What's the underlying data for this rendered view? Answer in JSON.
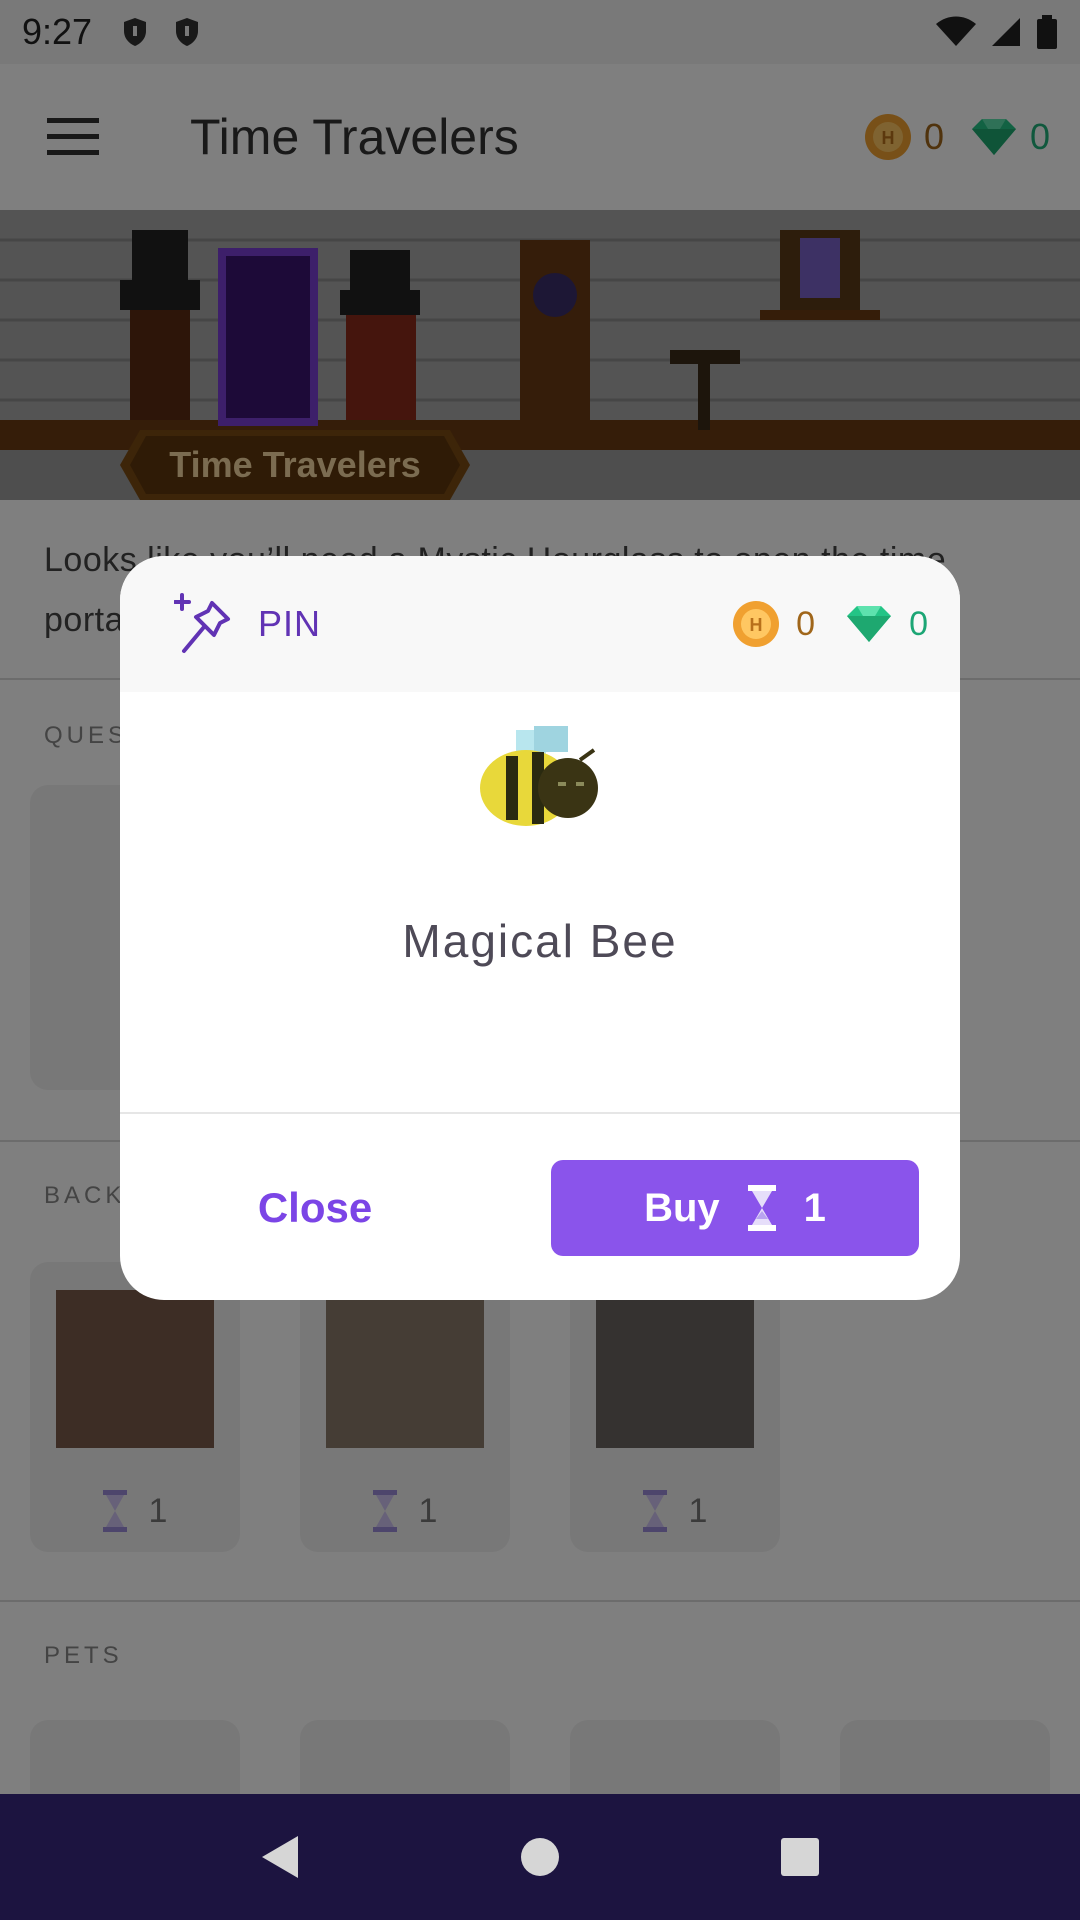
{
  "status_bar": {
    "time": "9:27"
  },
  "app_bar": {
    "title": "Time Travelers",
    "gold_count": "0",
    "gem_count": "0"
  },
  "banner": {
    "label": "Time Travelers"
  },
  "description": "Looks like you’ll need a Mystic Hourglass to open the time portal and summon the Time Travelers.",
  "sections": {
    "quests_title": "QUESTS",
    "backgrounds_title": "BACKGROUNDS",
    "pets_title": "PETS"
  },
  "backgrounds": [
    {
      "price": "1"
    },
    {
      "price": "1"
    },
    {
      "price": "1"
    }
  ],
  "dialog": {
    "pin_label": "PIN",
    "gold_count": "0",
    "gem_count": "0",
    "item_name": "Magical Bee",
    "close_label": "Close",
    "buy_label": "Buy",
    "buy_price": "1"
  },
  "colors": {
    "accent": "#8a54eb",
    "pin": "#6133b4",
    "gold": "#f0a030",
    "gem": "#24c486",
    "nav_bar": "#1c1440"
  }
}
